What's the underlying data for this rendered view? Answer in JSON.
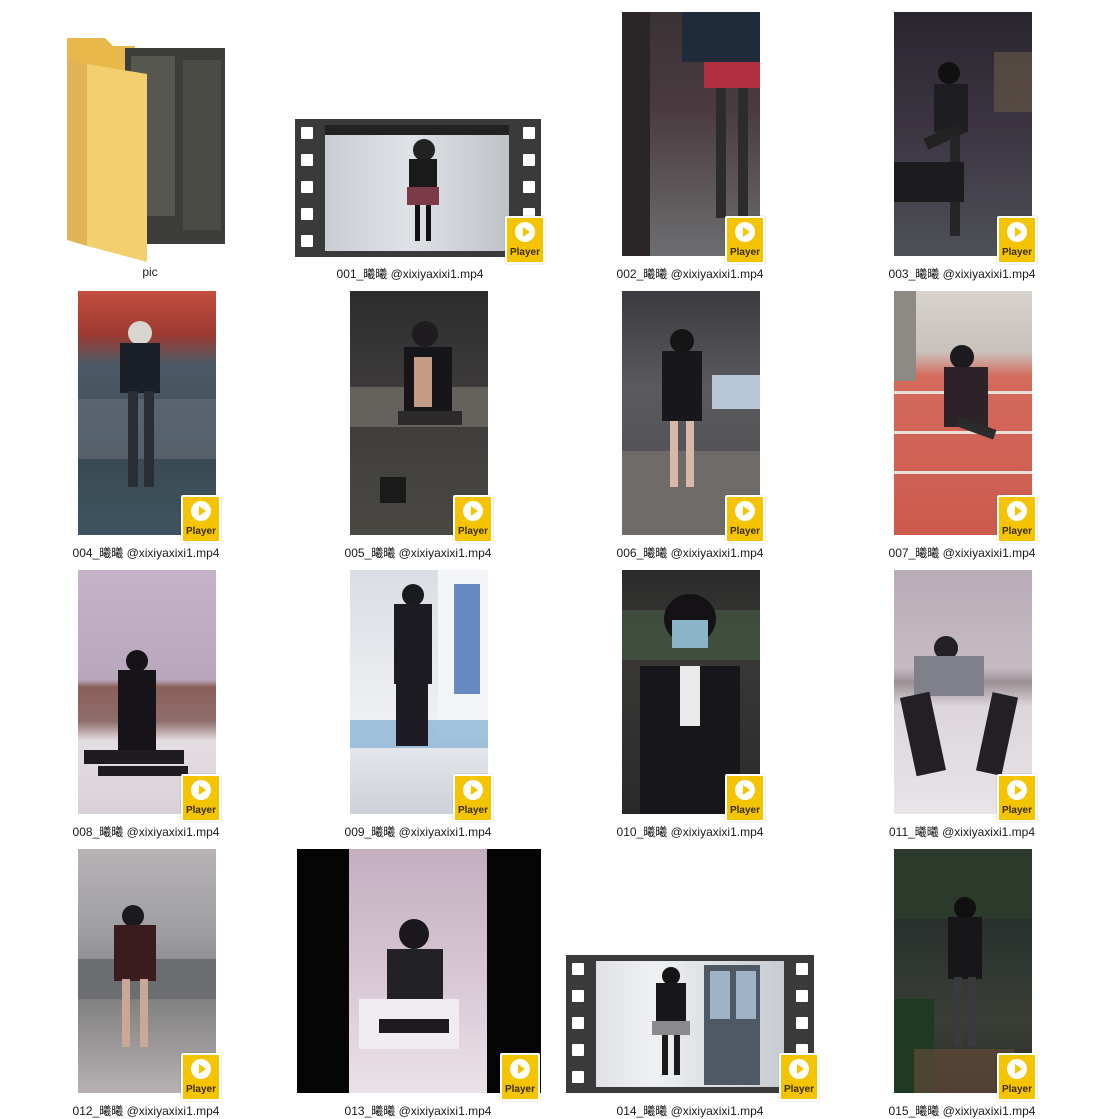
{
  "badge_label": "Player",
  "folder": {
    "name": "pic"
  },
  "files": [
    {
      "name": "001_曦曦 @xixiyaxixi1.mp4"
    },
    {
      "name": "002_曦曦 @xixiyaxixi1.mp4"
    },
    {
      "name": "003_曦曦 @xixiyaxixi1.mp4"
    },
    {
      "name": "004_曦曦 @xixiyaxixi1.mp4"
    },
    {
      "name": "005_曦曦 @xixiyaxixi1.mp4"
    },
    {
      "name": "006_曦曦 @xixiyaxixi1.mp4"
    },
    {
      "name": "007_曦曦 @xixiyaxixi1.mp4"
    },
    {
      "name": "008_曦曦 @xixiyaxixi1.mp4"
    },
    {
      "name": "009_曦曦 @xixiyaxixi1.mp4"
    },
    {
      "name": "010_曦曦 @xixiyaxixi1.mp4"
    },
    {
      "name": "011_曦曦 @xixiyaxixi1.mp4"
    },
    {
      "name": "012_曦曦 @xixiyaxixi1.mp4"
    },
    {
      "name": "013_曦曦 @xixiyaxixi1.mp4"
    },
    {
      "name": "014_曦曦 @xixiyaxixi1.mp4"
    },
    {
      "name": "015_曦曦 @xixiyaxixi1.mp4"
    }
  ],
  "colors": {
    "folder": "#f3cf6e",
    "badge": "#f5c400",
    "film": "#3a3a3a"
  }
}
